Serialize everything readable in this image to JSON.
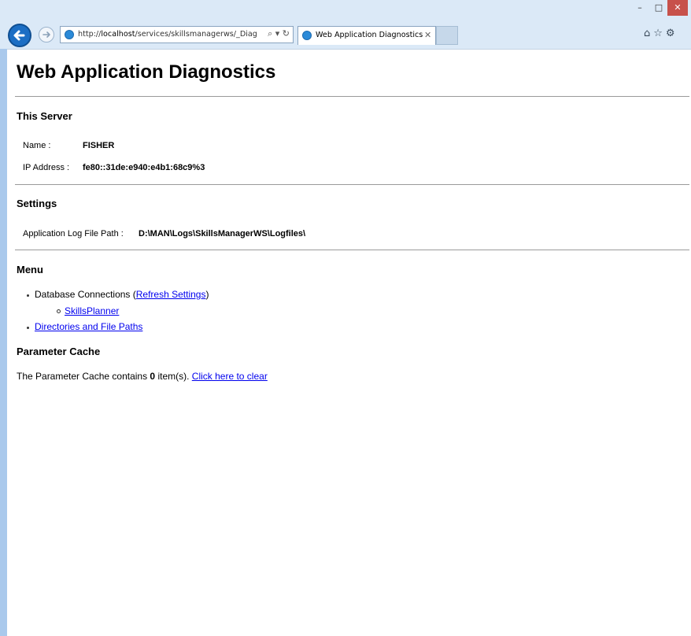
{
  "browser": {
    "address_url_prefix": "http://",
    "address_host": "localhost",
    "address_path": "/services/skillsmanagerws/_Diag",
    "tab_title": "Web Application Diagnostics",
    "window_controls": {
      "minimize": "–",
      "maximize": "□",
      "close": "✕"
    },
    "address_tools": "⌕ ▾ ↻",
    "tab_close": "✕",
    "toolbar_icons": "⌂☆⚙"
  },
  "page": {
    "title": "Web Application Diagnostics",
    "server": {
      "heading": "This Server",
      "name_label": "Name :",
      "name_value": "FISHER",
      "ip_label": "IP Address :",
      "ip_value": "fe80::31de:e940:e4b1:68c9%3"
    },
    "settings": {
      "heading": "Settings",
      "log_path_label": "Application Log File Path :",
      "log_path_value": "D:\\MAN\\Logs\\SkillsManagerWS\\Logfiles\\"
    },
    "menu": {
      "heading": "Menu",
      "db_connections_text": "Database Connections (",
      "refresh_link": "Refresh Settings",
      "db_connections_close": ")",
      "skillsplanner_link": "SkillsPlanner",
      "directories_link": "Directories and File Paths"
    },
    "cache": {
      "heading": "Parameter Cache",
      "text_before": "The Parameter Cache contains ",
      "count": "0",
      "text_after": " item(s). ",
      "clear_link": "Click here to clear"
    }
  }
}
